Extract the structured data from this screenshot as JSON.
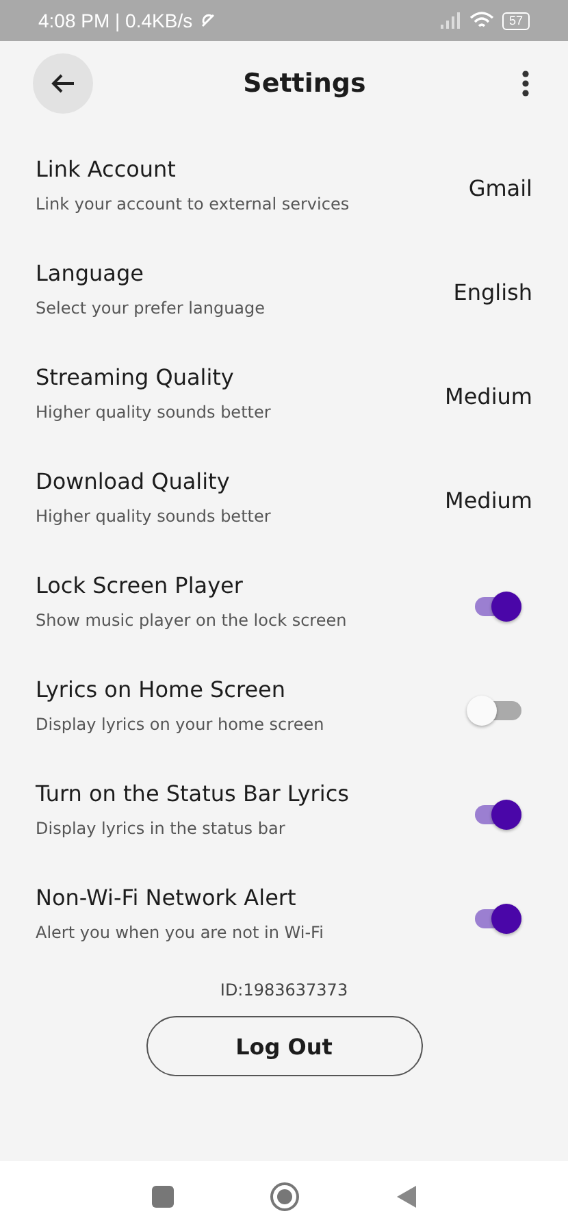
{
  "status_bar": {
    "time": "4:08 PM | 0.4KB/s",
    "battery": "57"
  },
  "header": {
    "title": "Settings"
  },
  "settings": [
    {
      "kind": "value",
      "title": "Link Account",
      "subtitle": "Link your account to external services",
      "value": "Gmail"
    },
    {
      "kind": "value",
      "title": "Language",
      "subtitle": "Select your prefer language",
      "value": "English"
    },
    {
      "kind": "value",
      "title": "Streaming Quality",
      "subtitle": "Higher quality sounds better",
      "value": "Medium"
    },
    {
      "kind": "value",
      "title": "Download Quality",
      "subtitle": "Higher quality sounds better",
      "value": "Medium"
    },
    {
      "kind": "toggle",
      "title": "Lock Screen Player",
      "subtitle": "Show music player on the lock screen",
      "on": true
    },
    {
      "kind": "toggle",
      "title": "Lyrics on Home Screen",
      "subtitle": "Display lyrics on your home screen",
      "on": false
    },
    {
      "kind": "toggle",
      "title": "Turn on the Status Bar Lyrics",
      "subtitle": "Display lyrics in the status bar",
      "on": true
    },
    {
      "kind": "toggle",
      "title": "Non-Wi-Fi Network Alert",
      "subtitle": "Alert you when you are not in Wi-Fi",
      "on": true
    }
  ],
  "account_id": "ID:1983637373",
  "logout_button": "Log Out"
}
